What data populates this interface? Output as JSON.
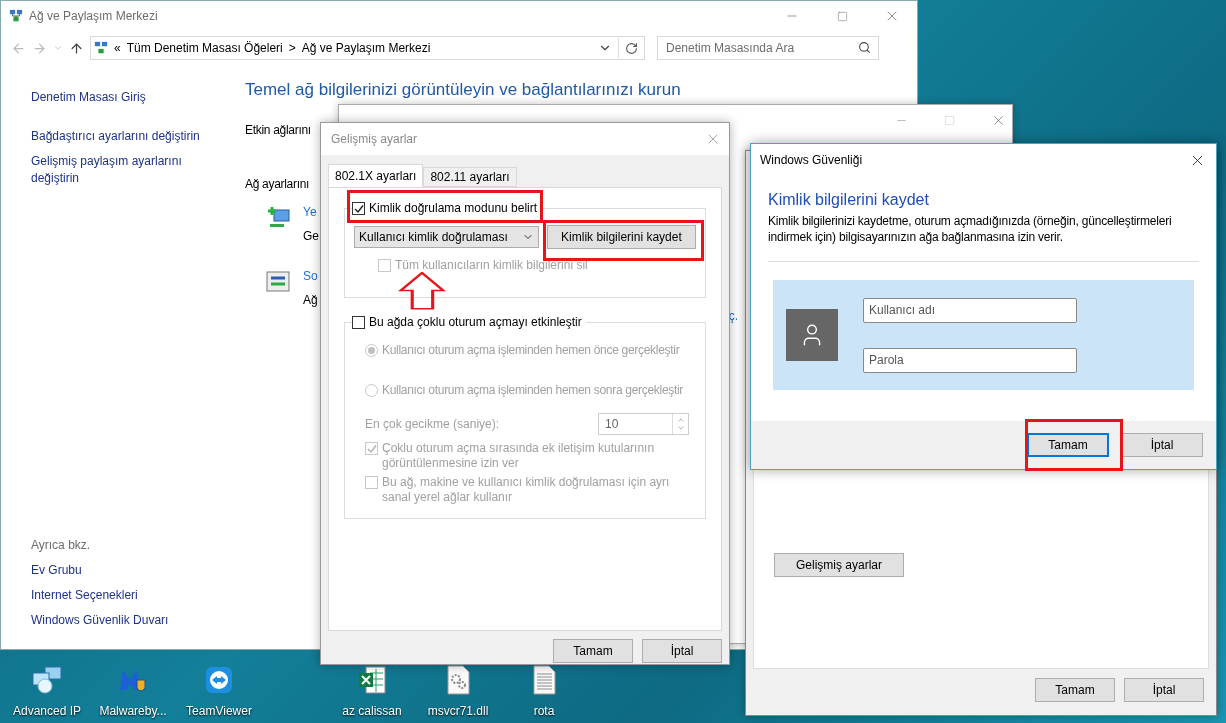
{
  "explorer": {
    "title": "Ağ ve Paylaşım Merkezi",
    "breadcrumb": {
      "overflow": "«",
      "items": [
        "Tüm Denetim Masası Öğeleri",
        "Ağ ve Paylaşım Merkezi"
      ],
      "separator": ">"
    },
    "search": {
      "placeholder": "Denetim Masasında Ara"
    },
    "sidebar": {
      "links": [
        "Denetim Masası Giriş",
        "Bağdaştırıcı ayarlarını değiştirin",
        "Gelişmiş paylaşım ayarlarını değiştirin"
      ],
      "see_also": {
        "title": "Ayrıca bkz.",
        "links": [
          "Ev Grubu",
          "Internet Seçenekleri",
          "Windows Güvenlik Duvarı"
        ]
      }
    },
    "heading": "Temel ağ bilgilerinizi görüntüleyin ve bağlantılarınızı kurun",
    "active_networks_label": "Etkin ağlarını",
    "settings_label": "Ağ ayarlarını",
    "settings_items": [
      {
        "kind": "new",
        "name": "Ye",
        "detail": "Ge"
      },
      {
        "kind": "troubleshoot",
        "name": "So",
        "detail": "Ağ"
      }
    ]
  },
  "properties_window": {
    "link_fragment": "ç."
  },
  "network_window": {
    "advanced_button": "Gelişmiş ayarlar",
    "buttons": [
      {
        "label": "Tamam"
      },
      {
        "label": "İptal"
      }
    ]
  },
  "advanced_dialog": {
    "title": "Gelişmiş ayarlar",
    "tabs": [
      {
        "label": "802.1X ayarları",
        "selected": true
      },
      {
        "label": "802.11 ayarları",
        "selected": false
      }
    ],
    "auth_mode": {
      "label": "Kimlik doğrulama modunu belirt",
      "checked": true,
      "disabled": false
    },
    "auth_select": {
      "value": "Kullanıcı kimlik doğrulaması"
    },
    "save_button": "Kimlik bilgilerini kaydet",
    "delete_all": {
      "label": "Tüm kullanıcıların kimlik bilgilerini sil",
      "checked": false,
      "disabled": true
    },
    "sso": {
      "label": "Bu ağda çoklu oturum açmayı etkinleştir",
      "checked": false,
      "disabled": false
    },
    "sso_options": [
      {
        "label": "Kullanıcı oturum açma işleminden hemen önce gerçekleştir",
        "selected": true,
        "disabled": true
      },
      {
        "label": "Kullanıcı oturum açma işleminden hemen sonra gerçekleştir",
        "selected": false,
        "disabled": true
      }
    ],
    "delay": {
      "label": "En çok gecikme (saniye):",
      "value": "10",
      "disabled": true
    },
    "sso_checks": [
      {
        "label": "Çoklu oturum açma sırasında ek iletişim kutularının görüntülenmesine izin ver",
        "checked": true,
        "disabled": true
      },
      {
        "label": "Bu ağ, makine ve kullanıcı kimlik doğrulaması için ayrı sanal yerel ağlar kullanır",
        "checked": false,
        "disabled": true
      }
    ],
    "buttons": [
      {
        "label": "Tamam"
      },
      {
        "label": "İptal"
      }
    ]
  },
  "security_dialog": {
    "title": "Windows Güvenliği",
    "heading": "Kimlik bilgilerini kaydet",
    "description": "Kimlik bilgilerinizi kaydetme, oturum açmadığınızda (örneğin, güncelleştirmeleri indirmek için) bilgisayarınızın ağa bağlanmasına izin verir.",
    "username": {
      "placeholder": "Kullanıcı adı"
    },
    "password": {
      "placeholder": "Parola"
    },
    "buttons": [
      {
        "label": "Tamam",
        "default": true
      },
      {
        "label": "İptal",
        "default": false
      }
    ]
  },
  "desktop_icons": [
    {
      "label": "Advanced IP",
      "kind": "network"
    },
    {
      "label": "Malwareby...",
      "kind": "shield"
    },
    {
      "label": "TeamViewer",
      "kind": "remote"
    },
    {
      "label": "az calissan",
      "kind": "spreadsheet"
    },
    {
      "label": "msvcr71.dll",
      "kind": "dll"
    },
    {
      "label": "rota",
      "kind": "text"
    }
  ]
}
